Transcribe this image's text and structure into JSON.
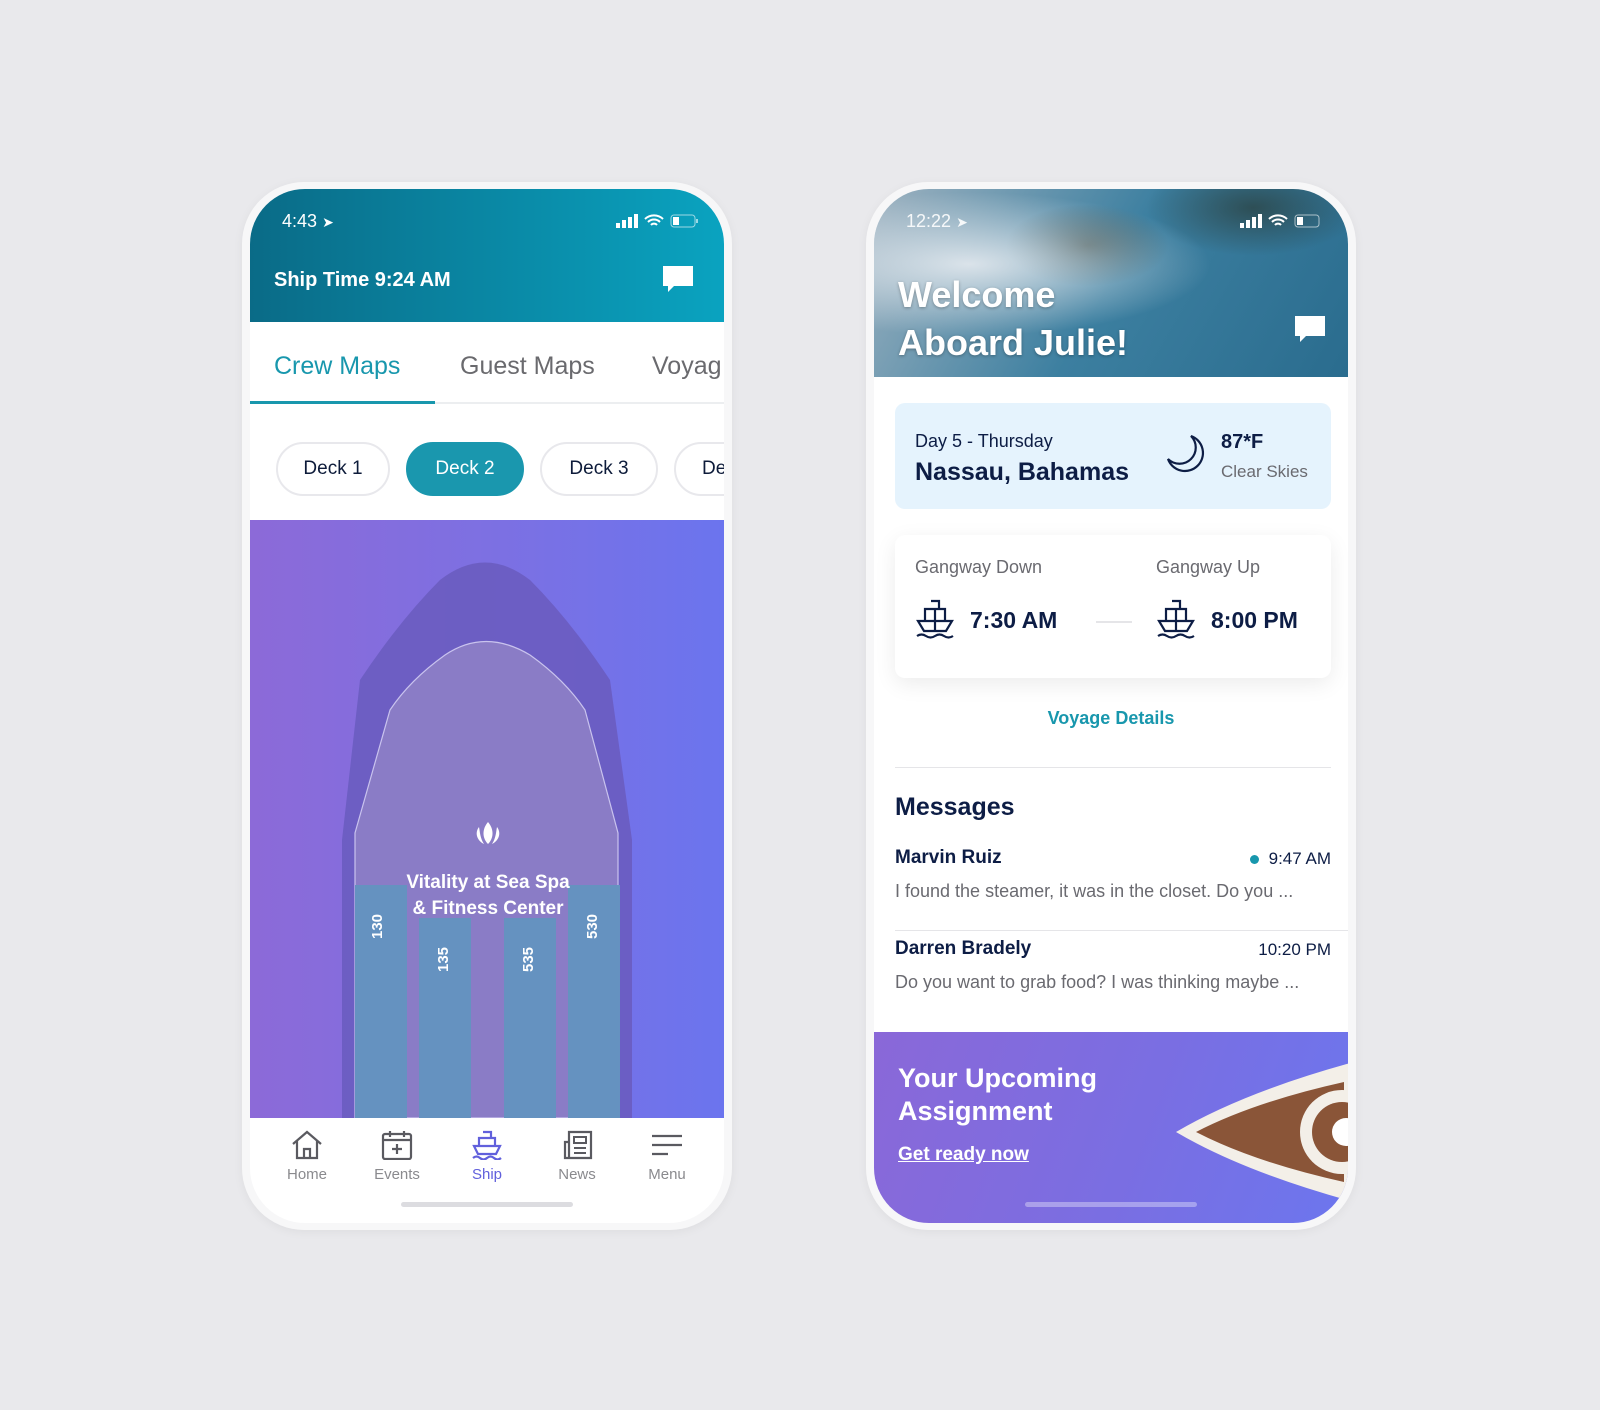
{
  "left_phone": {
    "status": {
      "time": "4:43"
    },
    "header": {
      "ship_time": "Ship Time 9:24 AM"
    },
    "tabs": [
      {
        "label": "Crew Maps",
        "active": true
      },
      {
        "label": "Guest Maps"
      },
      {
        "label": "Voyag"
      }
    ],
    "decks": [
      {
        "label": "Deck 1"
      },
      {
        "label": "Deck 2",
        "active": true
      },
      {
        "label": "Deck 3"
      },
      {
        "label": "De"
      }
    ],
    "map": {
      "venue_line1": "Vitality at Sea Spa",
      "venue_line2": "& Fitness Center",
      "venue_icon": "lotus-icon",
      "rooms": [
        "130",
        "135",
        "535",
        "530"
      ]
    },
    "nav": [
      {
        "label": "Home",
        "icon": "home-icon"
      },
      {
        "label": "Events",
        "icon": "calendar-add-icon"
      },
      {
        "label": "Ship",
        "icon": "ship-icon",
        "active": true
      },
      {
        "label": "News",
        "icon": "newspaper-icon"
      },
      {
        "label": "Menu",
        "icon": "menu-icon"
      }
    ],
    "colors": {
      "accent": "#1897ad",
      "active_nav": "#6160dc"
    }
  },
  "right_phone": {
    "status": {
      "time": "12:22"
    },
    "hero": {
      "line1": "Welcome",
      "line2": "Aboard Julie!"
    },
    "itinerary": {
      "day": "Day 5 - Thursday",
      "port": "Nassau, Bahamas",
      "temp": "87*F",
      "condition": "Clear Skies",
      "weather_icon": "moon-icon"
    },
    "gangway": {
      "down_label": "Gangway Down",
      "down_time": "7:30 AM",
      "up_label": "Gangway Up",
      "up_time": "8:00 PM"
    },
    "voyage_details": "Voyage Details",
    "messages": {
      "title": "Messages",
      "items": [
        {
          "name": "Marvin Ruiz",
          "time": "9:47 AM",
          "unread": true,
          "preview": "I found the steamer, it was in the closet. Do you ..."
        },
        {
          "name": "Darren Bradely",
          "time": "10:20 PM",
          "unread": false,
          "preview": "Do you want to grab food? I was thinking maybe ..."
        }
      ]
    },
    "banner": {
      "line1": "Your Upcoming",
      "line2": "Assignment",
      "link": "Get ready now"
    }
  }
}
